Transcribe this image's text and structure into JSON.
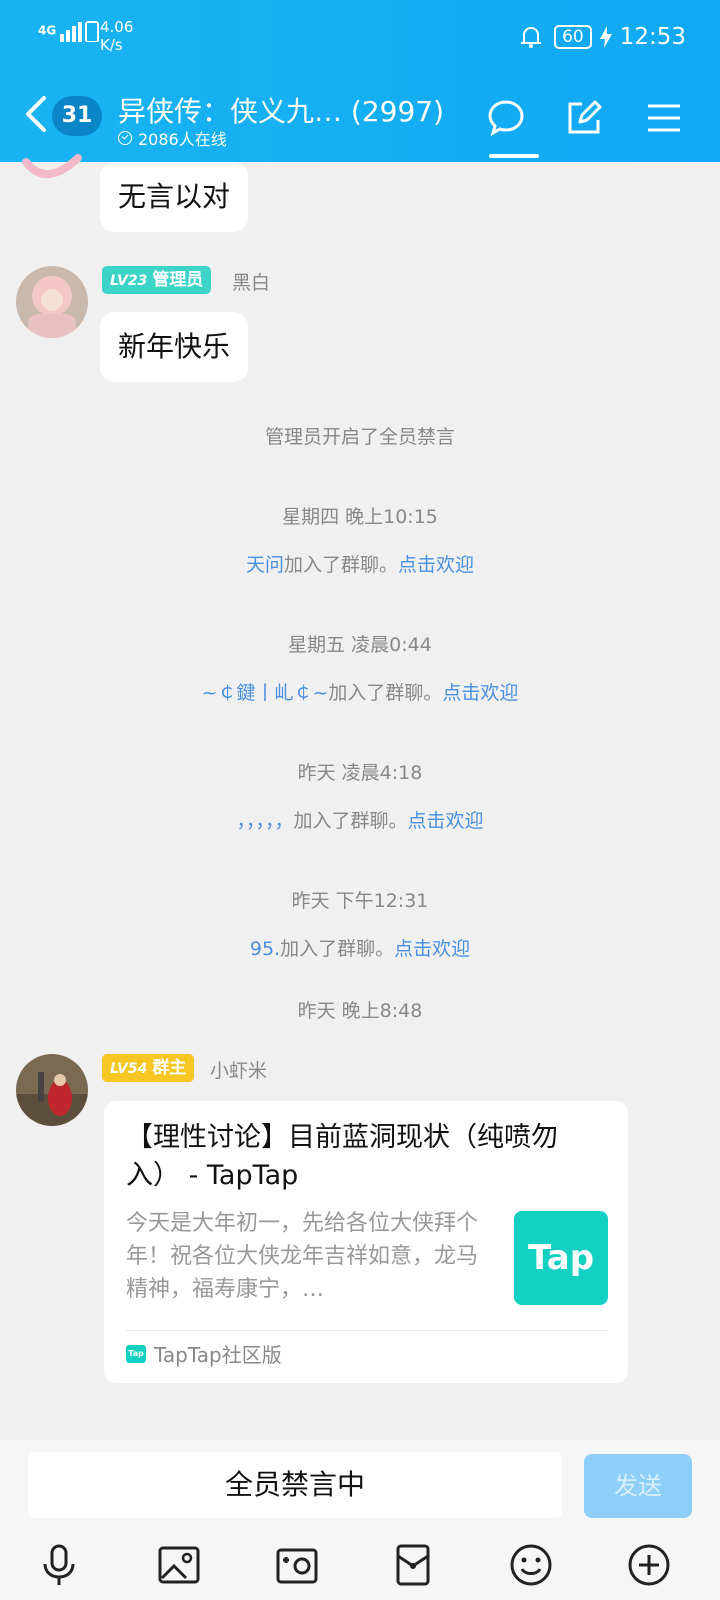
{
  "status_bar": {
    "network": "4G",
    "speed": "4.06",
    "speed_unit": "K/s",
    "battery": "60",
    "time": "12:53"
  },
  "header": {
    "unread_count": "31",
    "title": "异侠传：侠义九…  (2997)",
    "online": "2086人在线"
  },
  "messages": {
    "m1": {
      "text": "无言以对"
    },
    "m2": {
      "level": "LV23",
      "role": "管理员",
      "sender": "黑白",
      "text": "新年快乐"
    },
    "m3": {
      "level": "LV54",
      "role": "群主",
      "sender": "小虾米"
    }
  },
  "system": {
    "mute_notice": "管理员开启了全员禁言",
    "t1": "星期四  晚上10:15",
    "j1_name": "天问",
    "j1_text": "加入了群聊。",
    "j1_link": "点击欢迎",
    "t2": "星期五  凌晨0:44",
    "j2_name": "~￠鍵丨乢￠~",
    "j2_text": "加入了群聊。",
    "j2_link": "点击欢迎",
    "t3": "昨天  凌晨4:18",
    "j3_name": "，，，，，",
    "j3_text": "加入了群聊。",
    "j3_link": "点击欢迎",
    "t4": "昨天  下午12:31",
    "j4_name": "95.",
    "j4_text": "加入了群聊。",
    "j4_link": "点击欢迎",
    "t5": "昨天  晚上8:48"
  },
  "card": {
    "title": "【理性讨论】目前蓝洞现状（纯喷勿入） - TapTap",
    "description": "今天是大年初一，先给各位大侠拜个年！祝各位大侠龙年吉祥如意，龙马精神，福寿康宁，…",
    "logo_text": "Tap",
    "source_icon_text": "Tap",
    "source": "TapTap社区版"
  },
  "input_bar": {
    "placeholder": "全员禁言中",
    "send_label": "发送"
  },
  "colors": {
    "header": "#10a8f4",
    "link": "#4a90e2",
    "admin_badge": "#3ed3c8",
    "owner_badge": "#f6c623",
    "send_disabled": "#8dcff9"
  }
}
